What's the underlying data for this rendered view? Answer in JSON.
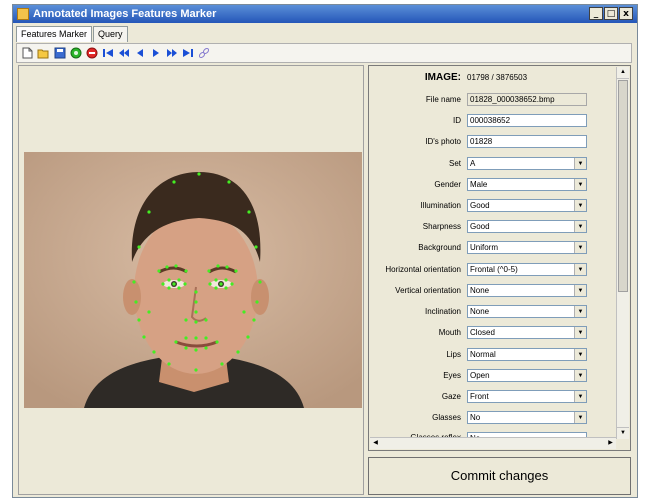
{
  "window": {
    "title": "Annotated Images Features Marker",
    "controls": {
      "minimize": "_",
      "maximize": "□",
      "close": "x"
    }
  },
  "tabs": [
    {
      "label": "Features Marker",
      "active": true
    },
    {
      "label": "Query",
      "active": false
    }
  ],
  "toolbar": {
    "icons": [
      "new-icon",
      "open-folder-icon",
      "save-icon",
      "record-green-icon",
      "stop-red-icon",
      "first-icon",
      "rewind-icon",
      "prev-icon",
      "next-icon",
      "fast-forward-icon",
      "last-icon",
      "link-icon"
    ]
  },
  "image_header": {
    "label": "IMAGE:",
    "counter": "01798 / 3876503"
  },
  "form": {
    "file_name": {
      "label": "File name",
      "value": "01828_000038652.bmp"
    },
    "id": {
      "label": "ID",
      "value": "000038652"
    },
    "id_photo": {
      "label": "ID's photo",
      "value": "01828"
    },
    "set": {
      "label": "Set",
      "value": "A"
    },
    "gender": {
      "label": "Gender",
      "value": "Male"
    },
    "illumination": {
      "label": "Illumination",
      "value": "Good"
    },
    "sharpness": {
      "label": "Sharpness",
      "value": "Good"
    },
    "background": {
      "label": "Background",
      "value": "Uniform"
    },
    "horizontal_orientation": {
      "label": "Horizontal orientation",
      "value": "Frontal (^0-5)"
    },
    "vertical_orientation": {
      "label": "Vertical orientation",
      "value": "None"
    },
    "inclination": {
      "label": "Inclination",
      "value": "None"
    },
    "mouth": {
      "label": "Mouth",
      "value": "Closed"
    },
    "lips": {
      "label": "Lips",
      "value": "Normal"
    },
    "eyes": {
      "label": "Eyes",
      "value": "Open"
    },
    "gaze": {
      "label": "Gaze",
      "value": "Front"
    },
    "glasses": {
      "label": "Glasses",
      "value": "No"
    },
    "glasses_reflex": {
      "label": "Glasses reflex",
      "value": "No"
    }
  },
  "commit_button": {
    "label": "Commit changes"
  },
  "colors": {
    "title_bar": "#2456b8",
    "window_bg": "#ece9d8",
    "photo_bg": "#c9ab92",
    "landmark": "#44ee22"
  }
}
